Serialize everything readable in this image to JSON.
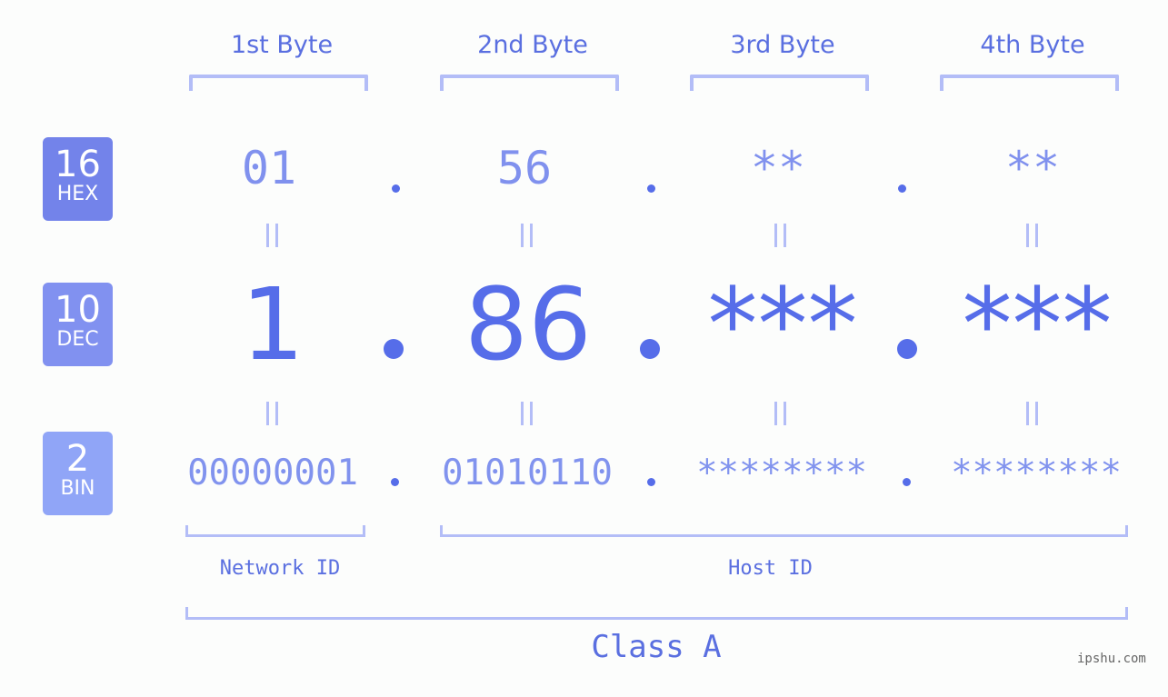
{
  "bytes": [
    {
      "title": "1st Byte",
      "hex": "01",
      "dec": "1",
      "bin": "00000001"
    },
    {
      "title": "2nd Byte",
      "hex": "56",
      "dec": "86",
      "bin": "01010110"
    },
    {
      "title": "3rd Byte",
      "hex": "**",
      "dec": "***",
      "bin": "********"
    },
    {
      "title": "4th Byte",
      "hex": "**",
      "dec": "***",
      "bin": "********"
    }
  ],
  "badges": {
    "hex": {
      "num": "16",
      "label": "HEX",
      "color": "#7383ea"
    },
    "dec": {
      "num": "10",
      "label": "DEC",
      "color": "#8191f0"
    },
    "bin": {
      "num": "2",
      "label": "BIN",
      "color": "#90a5f7"
    }
  },
  "equals_sign": "=",
  "network_id_label": "Network ID",
  "host_id_label": "Host ID",
  "class_label": "Class A",
  "watermark": "ipshu.com",
  "colors": {
    "primary": "#566de9",
    "light": "#8091ee",
    "bracket": "#b3bdf7"
  }
}
